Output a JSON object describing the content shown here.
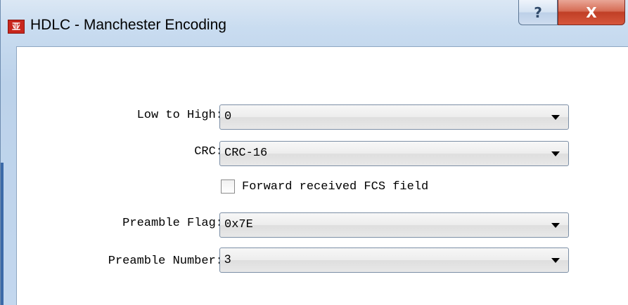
{
  "window": {
    "title": "HDLC - Manchester Encoding",
    "app_icon_text": "亚",
    "help_glyph": "?",
    "close_glyph": "X"
  },
  "form": {
    "low_to_high": {
      "label": "Low to High:",
      "value": "0"
    },
    "crc": {
      "label": "CRC:",
      "value": "CRC-16"
    },
    "forward_fcs": {
      "label": "Forward received FCS field",
      "checked": false
    },
    "preamble_flag": {
      "label": "Preamble Flag:",
      "value": "0x7E"
    },
    "preamble_number": {
      "label": "Preamble Number:",
      "value": "3"
    }
  }
}
